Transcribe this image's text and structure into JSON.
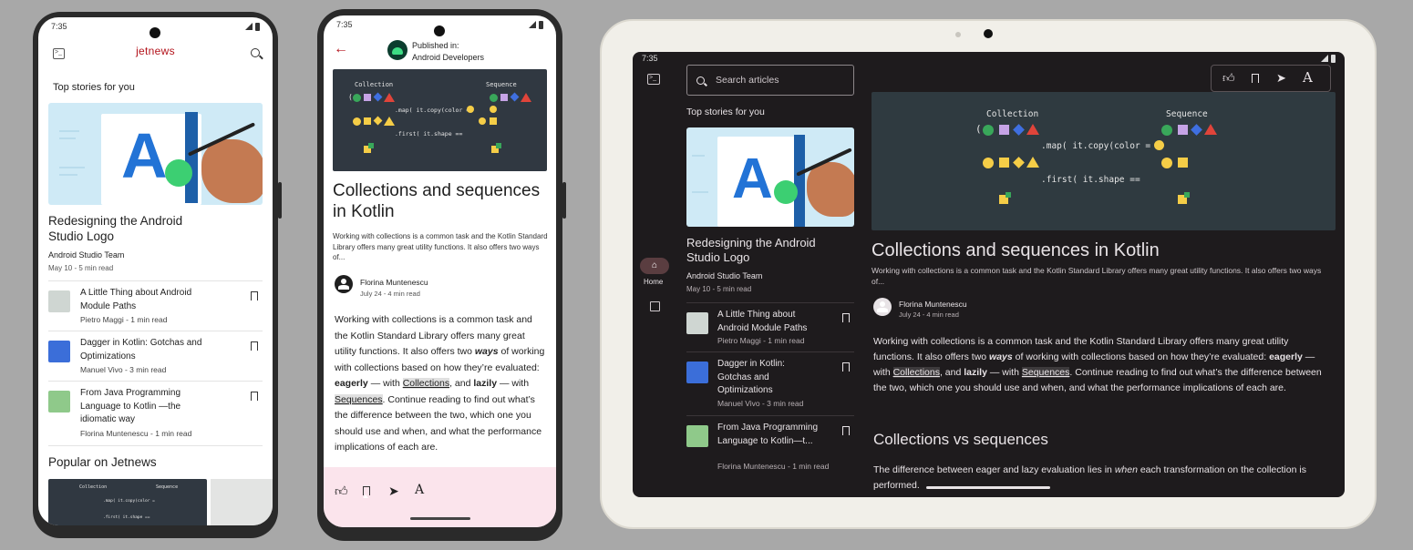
{
  "phone1": {
    "time": "7:35",
    "app_title": "jetnews",
    "section_title": "Top stories for you",
    "featured": {
      "title": "Redesigning the Android Studio Logo",
      "author": "Android Studio Team",
      "meta": "May 10 - 5 min read"
    },
    "posts": [
      {
        "title": "A Little Thing about Android Module Paths",
        "meta": "Pietro Maggi - 1 min read"
      },
      {
        "title": "Dagger in Kotlin: Gotchas and Optimizations",
        "meta": "Manuel Vivo - 3 min read"
      },
      {
        "title": "From Java Programming Language to Kotlin —the idiomatic way",
        "meta": "Florina Muntenescu - 1 min read"
      }
    ],
    "popular_title": "Popular on Jetnews"
  },
  "phone2": {
    "time": "7:35",
    "published_label": "Published in:",
    "publication": "Android Developers",
    "article_title": "Collections and sequences in Kotlin",
    "article_subtitle": "Working with collections is a common task and the Kotlin Standard Library offers many great utility functions. It also offers two ways of...",
    "author_name": "Florina Muntenescu",
    "author_meta": "July 24 - 4 min read",
    "body": {
      "p1": "Working with collections is a common task and the Kotlin Standard Library offers many great utility functions. It also offers two ",
      "ways": "ways",
      "p2": " of working with collections based on how they’re evaluated: ",
      "eagerly": "eagerly",
      "p3": " — with ",
      "collections": "Collections",
      "p4": ", and ",
      "lazily": "lazily",
      "p5": " — with ",
      "sequences": "Sequences",
      "p6": ". Continue reading to find out what’s the difference between the two, which one you should use and when, and what the performance implications of each are."
    }
  },
  "code_image": {
    "collection_label": "Collection",
    "sequence_label": "Sequence",
    "map_line": ".map( it.copy(color =",
    "first_line": ".first( it.shape =="
  },
  "tablet": {
    "time": "7:35",
    "search_placeholder": "Search articles",
    "section_title": "Top stories for you",
    "rail_home_label": "Home",
    "featured": {
      "title": "Redesigning the Android Studio Logo",
      "author": "Android Studio Team",
      "meta": "May 10 - 5 min read"
    },
    "posts": [
      {
        "title": "A Little Thing about Android Module Paths",
        "meta": "Pietro Maggi - 1 min read"
      },
      {
        "title": "Dagger in Kotlin: Gotchas and Optimizations",
        "meta": "Manuel Vivo - 3 min read"
      },
      {
        "title": "From Java Programming Language to Kotlin—t...",
        "meta": "Florina Muntenescu - 1 min read"
      }
    ],
    "article_title": "Collections and sequences in Kotlin",
    "article_subtitle": "Working with collections is a common task and the Kotlin Standard Library offers many great utility functions. It also offers two ways of...",
    "author_name": "Florina Muntenescu",
    "author_meta": "July 24 - 4 min read",
    "body": {
      "p1": "Working with collections is a common task and the Kotlin Standard Library offers many great utility functions. It also offers two ",
      "ways": "ways",
      "p2": " of working with collections based on how they’re evaluated: ",
      "eagerly": "eagerly",
      "p3": " — with ",
      "collections": "Collections",
      "p4": ", and ",
      "lazily": "lazily",
      "p5": " — with ",
      "sequences": "Sequences",
      "p6": ". Continue reading to find out what’s the difference between the two, which one you should use and when, and what the performance implications of each are."
    },
    "section2_title": "Collections vs sequences",
    "section2_p1": "The difference between eager and lazy evaluation lies in ",
    "section2_when": "when",
    "section2_p2": " each transformation on the collection is performed."
  },
  "icons": {
    "terminal": "terminal-icon",
    "search": "search-icon",
    "back": "back-arrow-icon",
    "like": "thumb-up-icon",
    "bookmark": "bookmark-icon",
    "share": "share-icon",
    "text_settings": "text-size-icon",
    "home": "home-icon",
    "list": "list-icon"
  },
  "colors": {
    "brand_red": "#b3131b",
    "tablet_bg": "#1e1b1d",
    "code_bg": "#303841",
    "bottom_bar": "#fbe4ec"
  }
}
